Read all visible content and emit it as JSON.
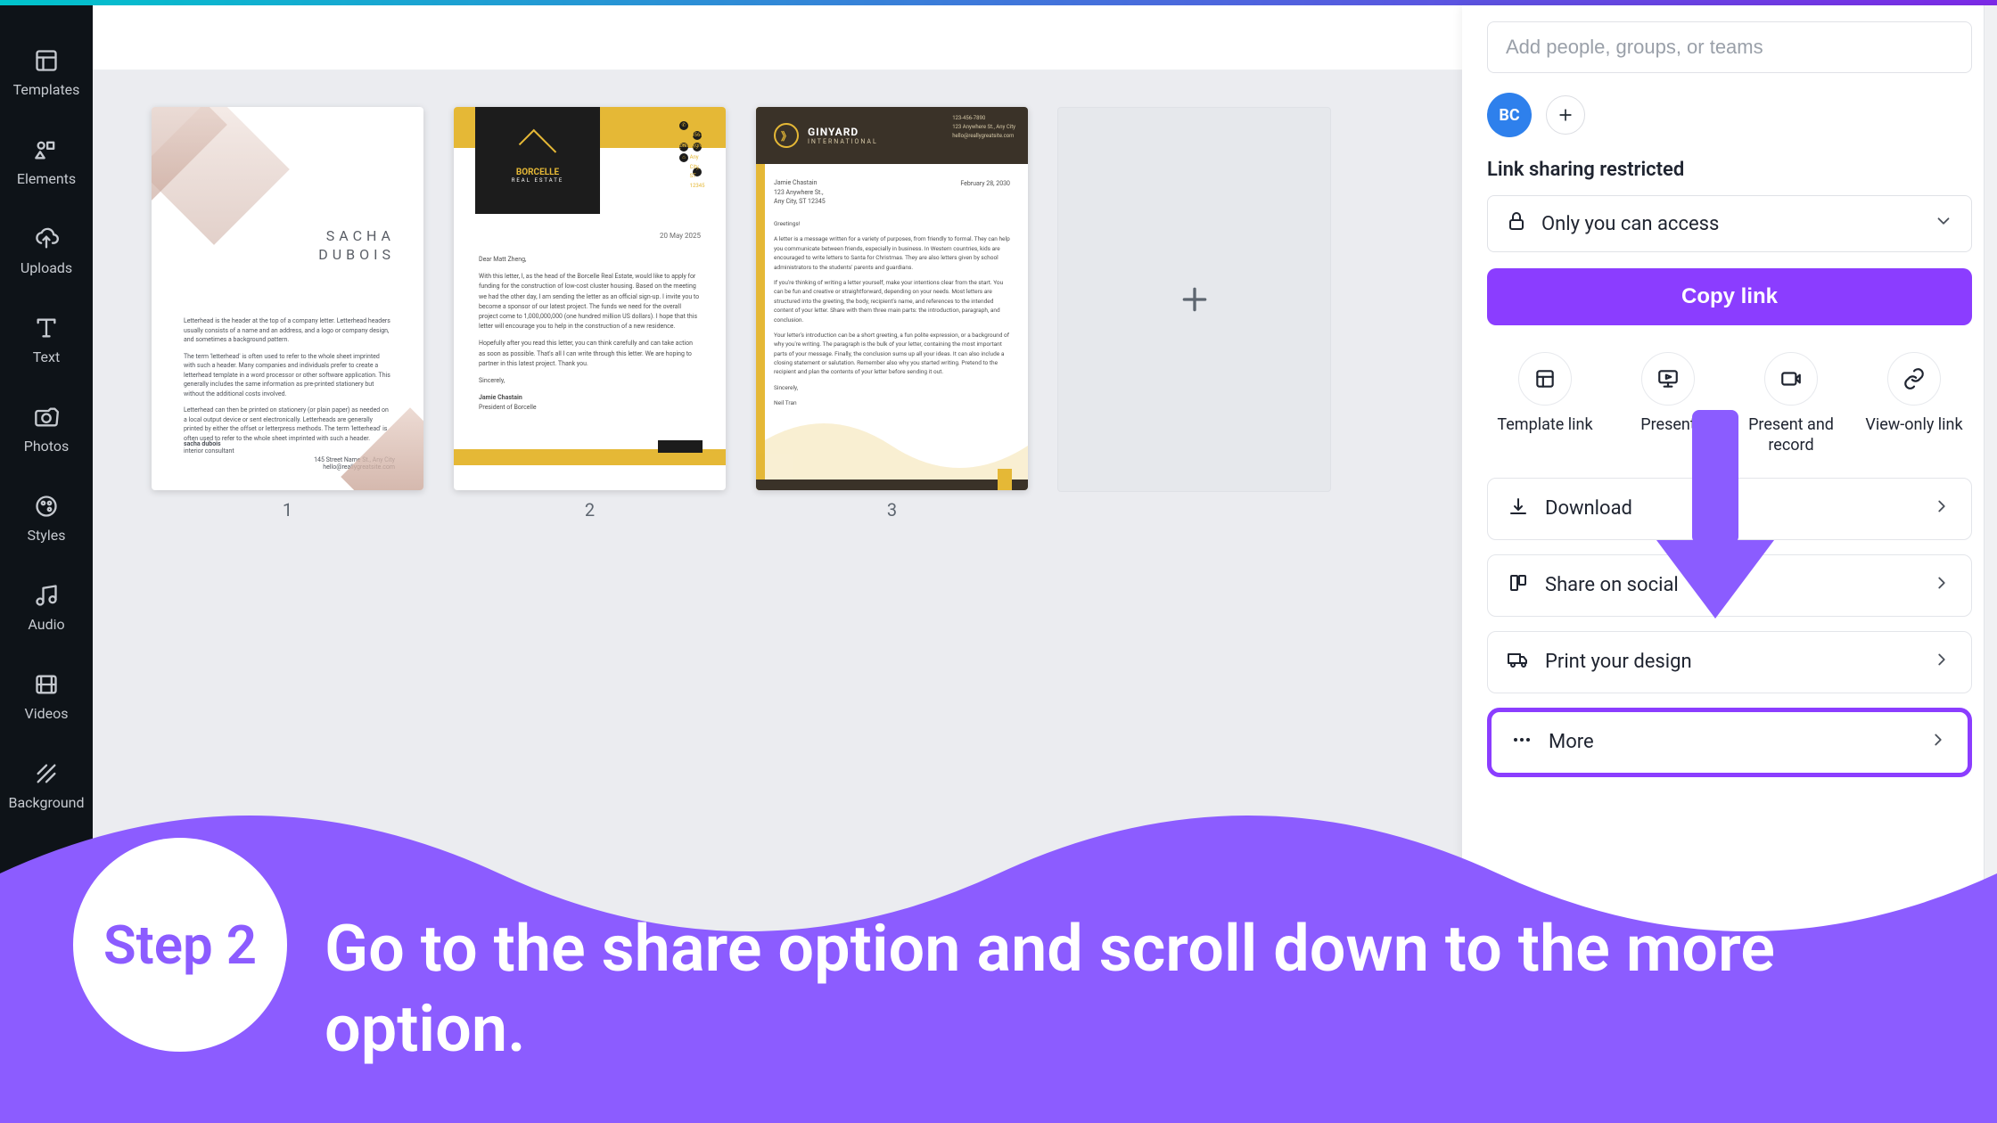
{
  "sidebar": {
    "items": [
      {
        "label": "Templates"
      },
      {
        "label": "Elements"
      },
      {
        "label": "Uploads"
      },
      {
        "label": "Text"
      },
      {
        "label": "Photos"
      },
      {
        "label": "Styles"
      },
      {
        "label": "Audio"
      },
      {
        "label": "Videos"
      },
      {
        "label": "Background"
      }
    ]
  },
  "pages": [
    {
      "num": "1",
      "name_line1": "SACHA",
      "name_line2": "DUBOIS",
      "sign_name": "sacha dubois",
      "sign_title": "interior consultant",
      "address": "145 Street Name St., Any City\nhello@reallygreatsite.com",
      "body": [
        "Letterhead is the header at the top of a company letter. Letterhead headers usually consists of a name and an address, and a logo or company design, and sometimes a background pattern.",
        "The term 'letterhead' is often used to refer to the whole sheet imprinted with such a header. Many companies and individuals prefer to create a letterhead template in a word processor or other software application. This generally includes the same information as pre-printed stationery but without the additional costs involved.",
        "Letterhead can then be printed on stationery (or plain paper) as needed on a local output device or sent electronically. Letterheads are generally printed by either the offset or letterpress methods. The term 'letterhead' is often used to refer to the whole sheet imprinted with such a header."
      ]
    },
    {
      "num": "2",
      "brand": "BORCELLE",
      "brand_sub": "REAL ESTATE",
      "contact": [
        "123-456-7890",
        "hello@reallygreatsite.com",
        "Any City, ST 12345"
      ],
      "date": "20 May 2025",
      "body": [
        "Dear Matt Zheng,",
        "With this letter, I, as the head of the Borcelle Real Estate, would like to apply for funding for the construction of low-cost cluster housing. Based on the meeting we had the other day, I am sending the letter as an official sign-up. I invite you to become a sponsor of our latest project. The funds we need for the overall project come to 1,000,000,000 (one hundred million US dollars). I hope that this letter will encourage you to help in the construction of a new residence.",
        "Hopefully after you read this letter, you can think carefully and can take action as soon as possible. That's all I can write through this letter. We are hoping to partner in this latest project. Thank you.",
        "Sincerely,",
        "Jamie Chastain",
        "President of Borcelle"
      ]
    },
    {
      "num": "3",
      "brand": "GINYARD",
      "brand_sub": "INTERNATIONAL",
      "contact": [
        "123-456-7890",
        "123 Anywhere St., Any City",
        "hello@reallygreatsite.com"
      ],
      "addr": "Jamie Chastain\n123 Anywhere St.,\nAny City, ST 12345",
      "date": "February 28, 2030",
      "body": [
        "Greetings!",
        "A letter is a message written for a variety of purposes, from friendly to formal. They can help you communicate between friends, especially in business. In Western countries, kids are encouraged to write letters to Santa for Christmas. They are also letters given by school administrators to the students' parents and guardians.",
        "If you're thinking of writing a letter yourself, make your intentions clear from the start. You can be fun and creative or straightforward, depending on your needs. Most letters are structured into the greeting, the body, recipient's name, and references to the intended content of your letter. Share with them three main parts: the introduction, paragraph, and conclusion.",
        "Your letter's introduction can be a short greeting, a fun polite expression, or a background of why you're writing. The paragraph is the bulk of your letter, containing the most important parts of your message. Finally, the conclusion sums up all your ideas. It can also include a closing statement or salutation. Remember also why you started writing. Pretend to the recipient and plan the contents of your letter before sending it out.",
        "Sincerely,",
        "Neil Tran"
      ]
    }
  ],
  "panel": {
    "search_placeholder": "Add people, groups, or teams",
    "avatar": "BC",
    "link_title": "Link sharing restricted",
    "access_label": "Only you can access",
    "copy_label": "Copy link",
    "grid": [
      {
        "label": "Template link"
      },
      {
        "label": "Present"
      },
      {
        "label": "Present and record"
      },
      {
        "label": "View-only link"
      }
    ],
    "options": [
      {
        "label": "Download"
      },
      {
        "label": "Share on social"
      },
      {
        "label": "Print your design"
      },
      {
        "label": "More"
      }
    ]
  },
  "banner": {
    "step": "Step 2",
    "text": "Go to the share option and scroll down to the more option."
  },
  "colors": {
    "accent": "#8b3dff"
  }
}
